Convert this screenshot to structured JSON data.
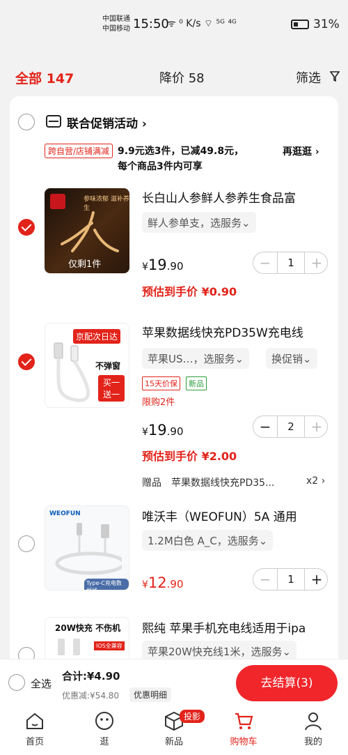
{
  "status_bar": {
    "carrier1": "中国联通",
    "carrier2": "中国移动",
    "time": "15:50",
    "icons": "ᯤ  ⁰ K/s  ⌔ ⁵ᴳ ⁴ᴳ",
    "battery": "31%"
  },
  "tabs": {
    "all_label": "全部 147",
    "drop_label": "降价 58",
    "filter_label": "筛选"
  },
  "promo": {
    "title": "联合促销活动",
    "tag": "跨自营/店铺满减",
    "line1": "9.9元选3件，已减49.8元，",
    "line2": "每个商品3件内可享",
    "link": "再逛逛 ›"
  },
  "items": [
    {
      "name": "长白山人参鲜人参养生食品富",
      "spec": "鲜人参单支，选服务⌄",
      "price_int": "19",
      "price_dec": ".90",
      "estimate": "预估到手价 ¥0.90",
      "qty": "1",
      "thumb_text": "仅剩1件",
      "thumb_caption": "参味浓郁 滋补养生",
      "checked": true
    },
    {
      "name": "苹果数据线快充PD35W充电线",
      "spec": "苹果US…，选服务⌄",
      "spec2": "换促销⌄",
      "tag1": "15天价保",
      "tag2": "新品",
      "limit": "限购2件",
      "price_int": "19",
      "price_dec": ".90",
      "estimate": "预估到手价 ¥2.00",
      "qty": "2",
      "gift_label": "赠品",
      "gift_name": "苹果数据线快充PD35...",
      "gift_qty": "x2 ›",
      "thumb_banner": "京配次日达",
      "thumb_text1": "不弹窗",
      "thumb_text2": "买一送一",
      "checked": true
    },
    {
      "name": "唯沃丰（WEOFUN）5A 通用",
      "spec": "1.2M白色 A_C，选服务⌄",
      "price_int": "12",
      "price_dec": ".90",
      "qty": "1",
      "thumb_brand": "WEOFUN",
      "thumb_caption": "Type-C充电数据线",
      "checked": false
    },
    {
      "name": "熙纯 苹果手机充电线适用于ipa",
      "spec": "苹果20W快充线1米，选服务⌄",
      "thumb_text": "20W快充 不伤机",
      "thumb_badge": "IOS全兼容",
      "checked": false
    }
  ],
  "bottom": {
    "select_all": "全选",
    "total": "合计:¥4.90",
    "saved": "优惠减:¥54.80",
    "detail": "优惠明细",
    "checkout": "去结算(3)"
  },
  "nav": {
    "home": "首页",
    "browse": "逛",
    "new": "新品",
    "new_badge": "投影",
    "cart": "购物车",
    "mine": "我的"
  },
  "colors": {
    "accent": "#e2231a"
  }
}
